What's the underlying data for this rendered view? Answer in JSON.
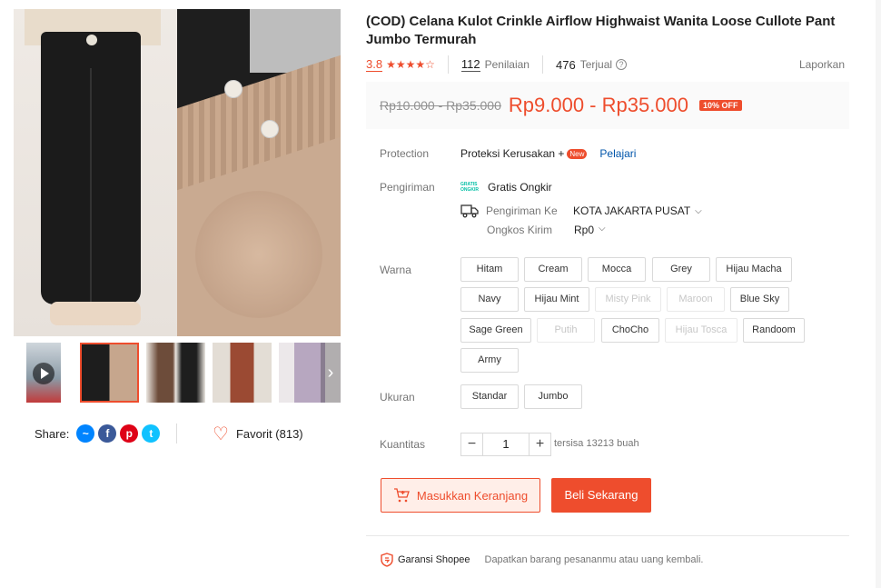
{
  "colors": {
    "accent": "#ee4d2d",
    "link": "#0055aa",
    "free_ship": "#00bfa5"
  },
  "gallery": {
    "thumb_count": 5,
    "share_label": "Share:",
    "share_icons": [
      "messenger-icon",
      "facebook-icon",
      "pinterest-icon",
      "twitter-icon"
    ],
    "favorite_label": "Favorit (813)"
  },
  "product": {
    "title": "(COD) Celana Kulot Crinkle Airflow Highwaist Wanita Loose Cullote Pant Jumbo Termurah",
    "rating": "3.8",
    "rating_value": 3.8,
    "reviews_count": "112",
    "reviews_label": "Penilaian",
    "sold_count": "476",
    "sold_label": "Terjual",
    "report_label": "Laporkan",
    "price_original": "Rp10.000 - Rp35.000",
    "price_current": "Rp9.000 - Rp35.000",
    "discount_badge": "10% OFF"
  },
  "protection": {
    "label": "Protection",
    "value": "Proteksi Kerusakan +",
    "badge": "New",
    "link": "Pelajari"
  },
  "shipping": {
    "label": "Pengiriman",
    "free_icon_text": "GRATIS ONGKIR",
    "free": "Gratis Ongkir",
    "to_label": "Pengiriman Ke",
    "to_value": "KOTA JAKARTA PUSAT",
    "cost_label": "Ongkos Kirim",
    "cost_value": "Rp0"
  },
  "variants": {
    "color_label": "Warna",
    "colors": [
      {
        "name": "Hitam",
        "available": true
      },
      {
        "name": "Cream",
        "available": true
      },
      {
        "name": "Mocca",
        "available": true
      },
      {
        "name": "Grey",
        "available": true
      },
      {
        "name": "Hijau Macha",
        "available": true
      },
      {
        "name": "Navy",
        "available": true
      },
      {
        "name": "Hijau Mint",
        "available": true
      },
      {
        "name": "Misty Pink",
        "available": false
      },
      {
        "name": "Maroon",
        "available": false
      },
      {
        "name": "Blue Sky",
        "available": true
      },
      {
        "name": "Sage Green",
        "available": true
      },
      {
        "name": "Putih",
        "available": false
      },
      {
        "name": "ChoCho",
        "available": true
      },
      {
        "name": "Hijau Tosca",
        "available": false
      },
      {
        "name": "Randoom",
        "available": true
      },
      {
        "name": "Army",
        "available": true
      }
    ],
    "size_label": "Ukuran",
    "sizes": [
      {
        "name": "Standar",
        "available": true
      },
      {
        "name": "Jumbo",
        "available": true
      }
    ]
  },
  "quantity": {
    "label": "Kuantitas",
    "value": "1",
    "minus": "−",
    "plus": "+",
    "stock_text": "tersisa 13213 buah"
  },
  "actions": {
    "add_to_cart": "Masukkan Keranjang",
    "buy_now": "Beli Sekarang"
  },
  "guarantee": {
    "title": "Garansi Shopee",
    "description": "Dapatkan barang pesananmu atau uang kembali."
  }
}
